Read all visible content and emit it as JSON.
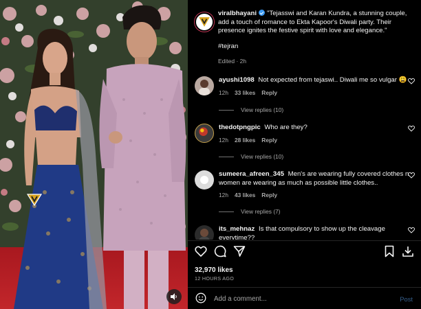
{
  "post": {
    "username": "viralbhayani",
    "caption": "\"Tejasswi and Karan Kundra, a stunning couple, add a touch of romance to Ekta Kapoor's Diwali party. Their presence ignites the festive spirit with love and elegance.\"",
    "hashtag": "#tejran",
    "edited": "Edited · 2h"
  },
  "comments": [
    {
      "username": "ayushi1098",
      "text": "Not expected from tejaswi.. Diwali me so vulgar 😩",
      "time": "12h",
      "likes": "33 likes",
      "reply": "Reply",
      "view_replies": "View replies (10)"
    },
    {
      "username": "thedotpngpic",
      "text": "Who are they?",
      "time": "12h",
      "likes": "28 likes",
      "reply": "Reply",
      "view_replies": "View replies (10)"
    },
    {
      "username": "sumeera_afreen_345",
      "text": "Men's are wearing fully covered clothes n women are wearing as much as possible little clothes..",
      "time": "12h",
      "likes": "43 likes",
      "reply": "Reply",
      "view_replies": "View replies (7)"
    },
    {
      "username": "its_mehnaz",
      "text": "Is that compulsory to show up the cleavage everytime??"
    }
  ],
  "stats": {
    "likes": "32,970 likes",
    "posted": "12 HOURS AGO"
  },
  "composer": {
    "placeholder": "Add a comment...",
    "post_label": "Post"
  },
  "icons": {
    "like": "heart-icon",
    "comment": "comment-icon",
    "share": "send-icon",
    "save": "bookmark-icon",
    "download": "download-icon",
    "emoji": "emoji-icon",
    "mute": "speaker-icon"
  },
  "colors": {
    "background": "#000000",
    "verified": "#3897f0",
    "muted_text": "#a8a8a8",
    "post_button": "#365f8c"
  }
}
